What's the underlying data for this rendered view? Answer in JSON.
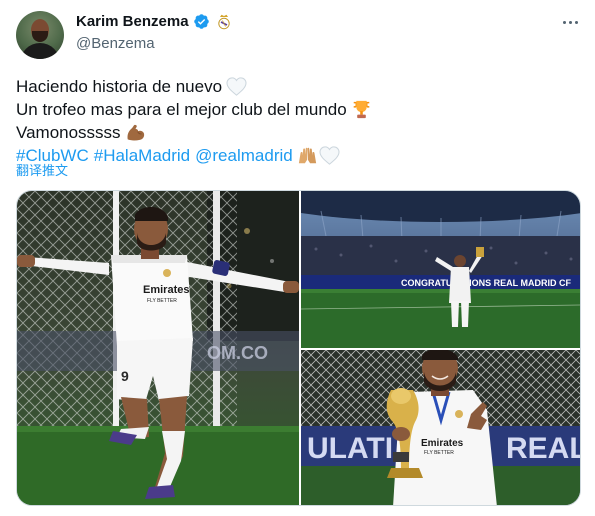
{
  "author": {
    "display_name": "Karim Benzema",
    "handle": "@Benzema",
    "verified": true,
    "badge_icon": "real-madrid-crest-icon",
    "accent_color": "#1d9bf0"
  },
  "tweet": {
    "lines": [
      {
        "text": "Haciendo historia de nuevo",
        "emoji": "white-heart-icon"
      },
      {
        "text": "Un trofeo mas para el mejor club del mundo",
        "emoji": "trophy-icon"
      },
      {
        "text": "Vamonosssss",
        "emoji": "flexed-biceps-icon"
      }
    ],
    "hashtags": [
      "#ClubWC",
      "#HalaMadrid"
    ],
    "mention": "@realmadrid",
    "hashtag_line_emojis": [
      "raising-hands-icon",
      "white-heart-icon"
    ],
    "translate_label": "翻译推文"
  },
  "media": {
    "photos": [
      {
        "subject": "player-celebrating-photo"
      },
      {
        "subject": "stadium-celebration-photo",
        "banner_text": "CONGRATULATIONS REAL MADRID CF"
      },
      {
        "subject": "player-with-trophy-photo",
        "kit_text": "Emirates FLY BETTER"
      }
    ],
    "photo1_kit_text": "Emirates FLY BETTER",
    "photo1_board_text": "OM.CO",
    "photo3_board_text": "ULATI",
    "photo3_board_text_right": "REAL"
  }
}
